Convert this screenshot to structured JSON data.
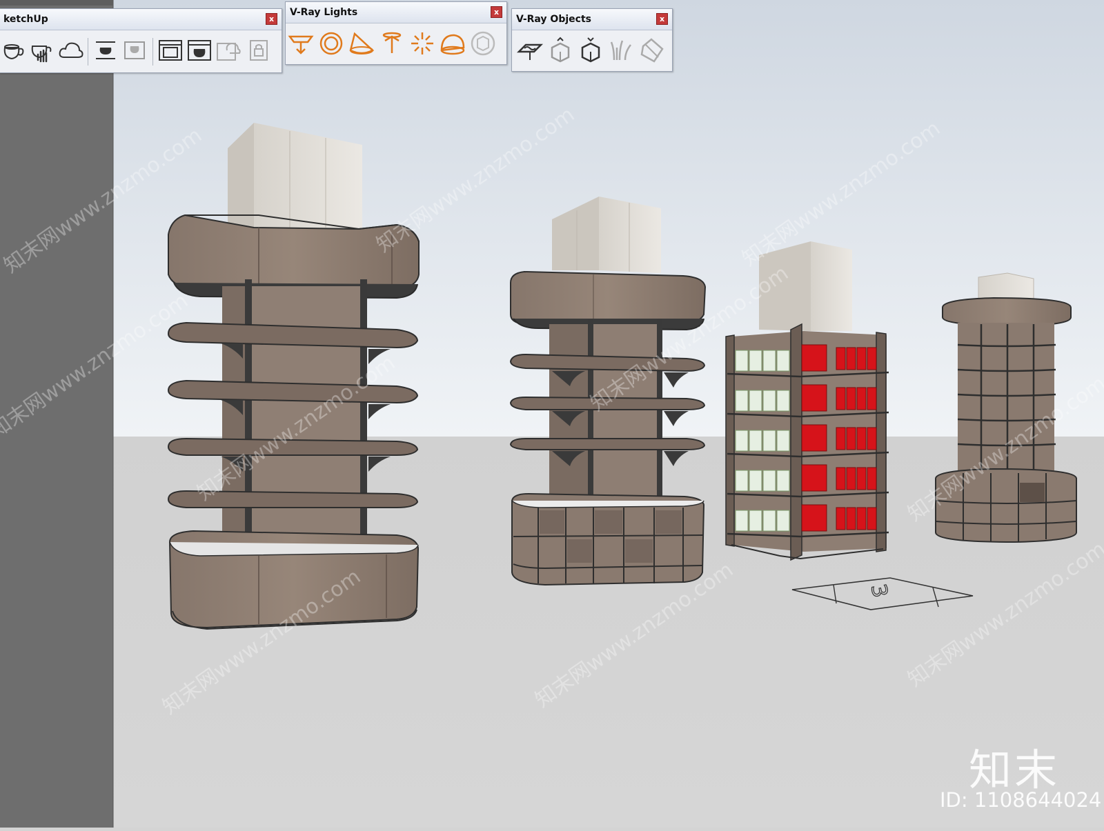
{
  "toolbars": {
    "sketchup": {
      "title": "ketchUp",
      "close_label": "x"
    },
    "vray_lights": {
      "title": "V-Ray Lights",
      "close_label": "x"
    },
    "vray_objects": {
      "title": "V-Ray Objects",
      "close_label": "x"
    }
  },
  "icons": {
    "sketchup": [
      "teapot-render-icon",
      "teapot-interactive-render-icon",
      "cloud-render-icon",
      "frame-buffer-teapot-icon",
      "render-settings-icon",
      "render-region-icon",
      "batch-render-icon",
      "cloud-sync-icon",
      "lock-icon"
    ],
    "vray_lights": [
      "rectangle-light-icon",
      "sphere-light-icon",
      "spot-light-icon",
      "ies-light-icon",
      "omni-light-icon",
      "dome-light-icon",
      "mesh-light-icon"
    ],
    "vray_objects": [
      "infinite-plane-icon",
      "export-proxy-icon",
      "import-proxy-icon",
      "fur-icon",
      "mesh-clipper-icon"
    ]
  },
  "scene": {
    "marker_label": "3",
    "watermark_text": "知末网www.znzmo.com"
  },
  "branding": {
    "logo": "知末",
    "id_text": "ID: 1108644024"
  },
  "colors": {
    "viewport_bg": "#d4d4d4",
    "sky_top": "#cfd7e1",
    "sky_bottom": "#f0f3f6",
    "ground": "#d3d3d3",
    "left_panel": "#6e6e6e",
    "wood_dark": "#7c6c62",
    "wood": "#8c7b70",
    "wood_light": "#9a8a7f",
    "stone": "#e1ddd6",
    "metal": "#3a3a3a",
    "product_red": "#d6131a",
    "product_green": "#e6efe2",
    "close_red": "#c43a3a",
    "lights_icon_orange": "#e07a1c"
  }
}
